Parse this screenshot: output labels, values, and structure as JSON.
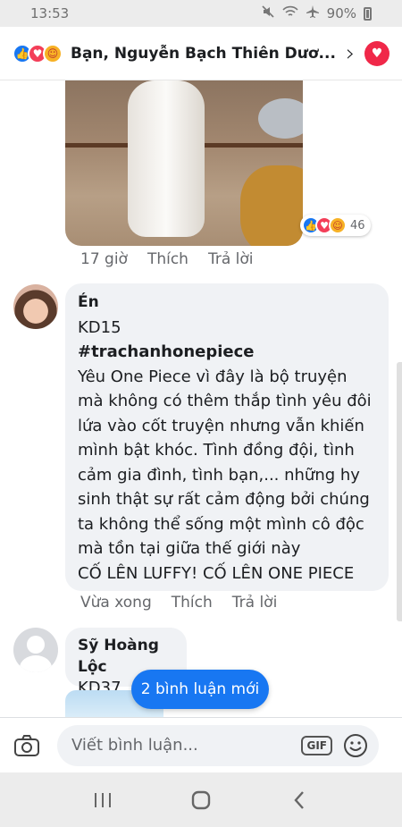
{
  "status_bar": {
    "time": "13:53",
    "battery": "90%"
  },
  "header": {
    "title": "Bạn, Nguyễn Bạch Thiên Dươ..."
  },
  "post_photo": {
    "reaction_count": "46"
  },
  "comments": [
    {
      "time": "17 giờ",
      "like_label": "Thích",
      "reply_label": "Trả lời"
    },
    {
      "author": "Én",
      "lines": [
        "KD15",
        "#trachanhonepiece",
        "Yêu One Piece vì đây là bộ truyện",
        "mà không có thêm thắp tình yêu đôi",
        "lứa vào cốt truyện nhưng vẫn khiến",
        "mình bật khóc. Tình đồng đội, tình",
        "cảm gia đình, tình bạn,... những hy",
        "sinh thật sự rất cảm động bởi chúng",
        "ta không thể sống một mình cô độc",
        "mà tồn tại giữa thế giới này",
        "CỐ LÊN LUFFY! CỐ LÊN ONE PIECE"
      ],
      "time": "Vừa xong",
      "like_label": "Thích",
      "reply_label": "Trả lời"
    },
    {
      "author": "Sỹ Hoàng Lộc",
      "text": "KD37"
    }
  ],
  "new_comments_toast": "2 bình luận mới",
  "composer": {
    "placeholder": "Viết bình luận...",
    "gif_label": "GIF"
  },
  "colors": {
    "accent": "#1877f2",
    "love": "#f33e58",
    "bubble": "#f0f2f5"
  }
}
